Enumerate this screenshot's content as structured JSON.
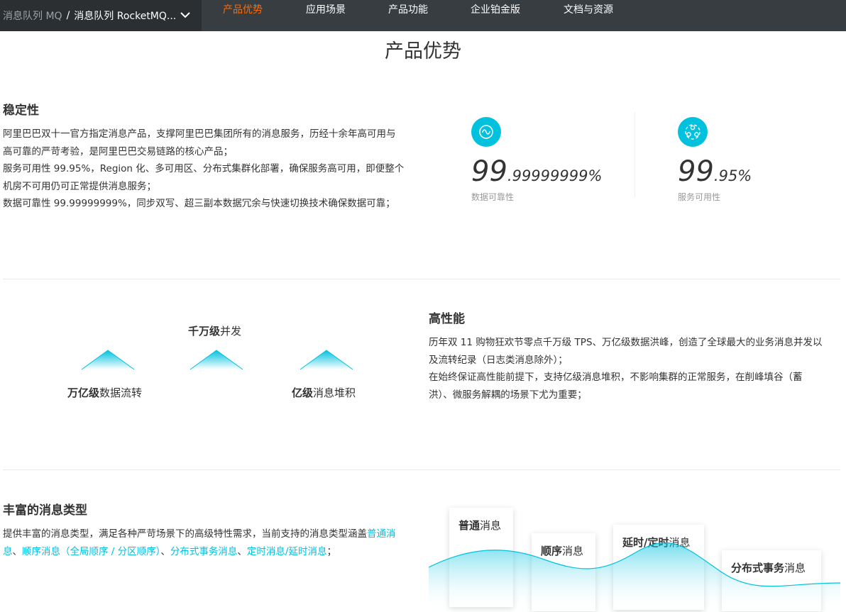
{
  "nav": {
    "breadcrumb_parent": "消息队列 MQ",
    "breadcrumb_sep": "/",
    "breadcrumb_current": "消息队列 RocketMQ...",
    "tabs": [
      {
        "label": "产品优势",
        "active": true
      },
      {
        "label": "应用场景",
        "active": false
      },
      {
        "label": "产品功能",
        "active": false
      },
      {
        "label": "企业铂金版",
        "active": false
      },
      {
        "label": "文档与资源",
        "active": false
      }
    ]
  },
  "page_title": "产品优势",
  "stability": {
    "heading": "稳定性",
    "lines": [
      "阿里巴巴双十一官方指定消息产品，支撑阿里巴巴集团所有的消息服务，历经十余年高可用与",
      "高可靠的严苛考验，是阿里巴巴交易链路的核心产品；",
      "服务可用性 99.95%，Region 化、多可用区、分布式集群化部署，确保服务高可用，即便整个",
      "机房不可用仍可正常提供消息服务；",
      "数据可靠性 99.99999999%，同步双写、超三副本数据冗余与快速切换技术确保数据可靠；"
    ],
    "stats": [
      {
        "icon": "wave-circle-icon",
        "big": "99",
        "small": ".99999999%",
        "label": "数据可靠性"
      },
      {
        "icon": "cluster-icon",
        "big": "99",
        "small": ".95%",
        "label": "服务可用性"
      }
    ]
  },
  "performance": {
    "heading": "高性能",
    "lines": [
      "历年双 11 购物狂欢节零点千万级 TPS、万亿级数据洪峰，创造了全球最大的业务消息并发以",
      "及流转纪录（日志类消息除外）；",
      "在始终保证高性能前提下，支持亿级消息堆积，不影响集群的正常服务，在削峰填谷（蓄",
      "洪）、微服务解耦的场景下尤为重要；"
    ],
    "labels": [
      {
        "bold": "千万级",
        "rest": "并发"
      },
      {
        "bold": "万亿级",
        "rest": "数据流转"
      },
      {
        "bold": "亿级",
        "rest": "消息堆积"
      }
    ]
  },
  "message_types": {
    "heading": "丰富的消息类型",
    "intro": "提供丰富的消息类型，满足各种严苛场景下的高级特性需求，当前支持的消息类型涵盖",
    "link1_a": "普通消",
    "link1_b": "息",
    "sep1": "、",
    "link2": "顺序消息（全局顺序 / 分区顺序）",
    "sep2": "、",
    "link3": "分布式事务消息",
    "sep3": "、",
    "link4": "定时消息/延时消息",
    "end": "；",
    "cards": [
      {
        "bold": "普通",
        "rest": "消息"
      },
      {
        "bold": "顺序",
        "rest": "消息"
      },
      {
        "bold": "延时/定时",
        "rest": "消息"
      },
      {
        "bold": "分布式事务",
        "rest": "消息"
      }
    ]
  },
  "colors": {
    "accent": "#00c1de",
    "active_tab": "#ff6a00",
    "nav_bg": "#373d41"
  }
}
